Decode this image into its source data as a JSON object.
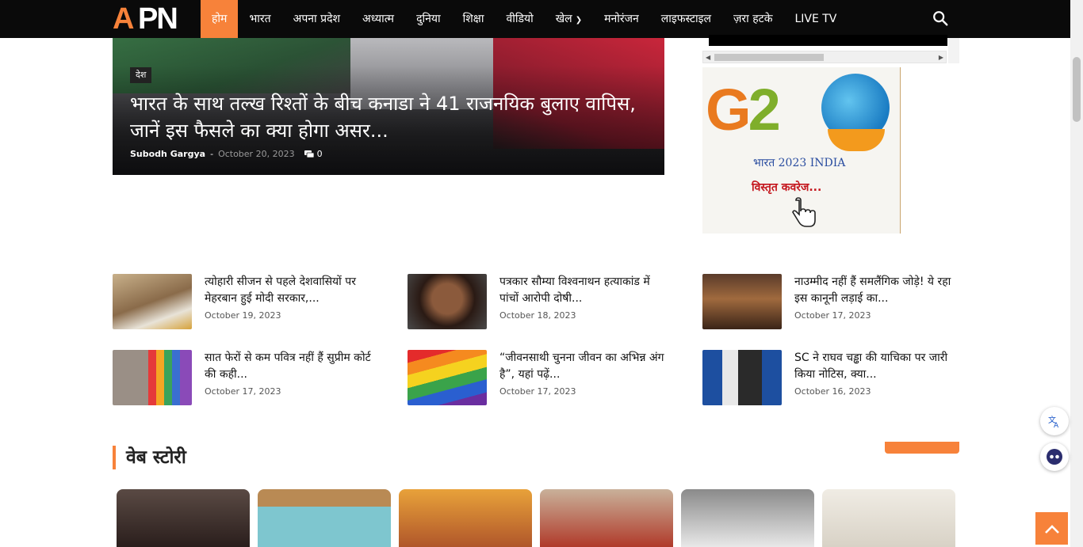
{
  "brand": {
    "logo_a": "A",
    "logo_pn": "PN"
  },
  "nav": {
    "items": [
      {
        "label": "होम",
        "active": true
      },
      {
        "label": "भारत"
      },
      {
        "label": "अपना प्रदेश"
      },
      {
        "label": "अध्यात्म"
      },
      {
        "label": "दुनिया"
      },
      {
        "label": "शिक्षा"
      },
      {
        "label": "वीडियो"
      },
      {
        "label": "खेल",
        "has_dropdown": true
      },
      {
        "label": "मनोरंजन"
      },
      {
        "label": "लाइफस्टाइल"
      },
      {
        "label": "ज़रा हटके"
      },
      {
        "label": "LIVE TV"
      }
    ],
    "search_icon": "search-icon",
    "accent_color": "#f7823a"
  },
  "hero": {
    "category": "देश",
    "title": "भारत के साथ तल्ख रिश्तों के बीच कनाडा ने 41 राजनयिक बुलाए वापिस, जानें इस फैसले का क्या होगा असर...",
    "author": "Subodh Gargya",
    "separator": "-",
    "date": "October 20, 2023",
    "comments": "0"
  },
  "sidebar_ad": {
    "g20_g": "G",
    "g20_2": "2",
    "year_text": "भारत 2023 INDIA",
    "coverage_text": "विस्तृत कवरेज..."
  },
  "news": [
    {
      "title": "त्योहारी सीजन से पहले देशवासियों पर मेहरबान हुई मोदी सरकार,...",
      "date": "October 19, 2023"
    },
    {
      "title": "पत्रकार सौम्या विश्वनाथन हत्याकांड में पांचों आरोपी दोषी...",
      "date": "October 18, 2023"
    },
    {
      "title": "नाउम्मीद नहीं हैं समलैंगिक जोड़े! ये रहा इस कानूनी लड़ाई का...",
      "date": "October 17, 2023"
    },
    {
      "title": "सात फेरों से कम पवित्र नहीं हैं सुप्रीम कोर्ट की कही...",
      "date": "October 17, 2023"
    },
    {
      "title": "“जीवनसाथी चुनना जीवन का अभिन्न अंग है”, यहां पढ़ें...",
      "date": "October 17, 2023"
    },
    {
      "title": "SC ने राघव चड्ढा की याचिका पर जारी किया नोटिस, क्या...",
      "date": "October 16, 2023"
    }
  ],
  "web_story": {
    "heading": "वेब स्टोरी"
  },
  "floating": {
    "translate_icon": "translate-icon",
    "assistant_icon": "assistant-icon",
    "scroll_top_icon": "chevron-up-icon"
  }
}
